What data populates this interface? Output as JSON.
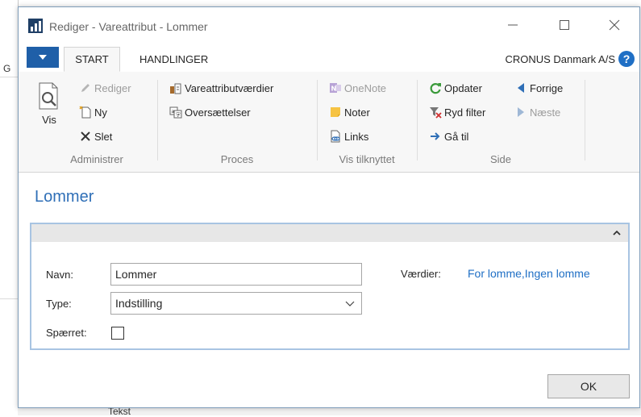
{
  "window": {
    "title": "Rediger - Vareattribut - Lommer"
  },
  "background": {
    "left_letter": "G",
    "bottom_text": "Tekst"
  },
  "tabs": {
    "start": "START",
    "handlinger": "HANDLINGER"
  },
  "company": "CRONUS Danmark A/S",
  "help": "?",
  "ribbon": {
    "vis": "Vis",
    "rediger": "Rediger",
    "ny": "Ny",
    "slet": "Slet",
    "group_administrer": "Administrer",
    "vareattributvaerdier": "Vareattributværdier",
    "oversaettelser": "Oversættelser",
    "group_proces": "Proces",
    "onenote": "OneNote",
    "noter": "Noter",
    "links": "Links",
    "group_vis_tilknyttet": "Vis tilknyttet",
    "opdater": "Opdater",
    "ryd_filter": "Ryd filter",
    "ga_til": "Gå til",
    "forrige": "Forrige",
    "naeste": "Næste",
    "group_side": "Side"
  },
  "page": {
    "heading": "Lommer"
  },
  "form": {
    "navn_label": "Navn:",
    "navn_value": "Lommer",
    "type_label": "Type:",
    "type_value": "Indstilling",
    "spaerret_label": "Spærret:",
    "vaerdier_label": "Værdier:",
    "vaerdier_value": "For lomme,Ingen lomme"
  },
  "buttons": {
    "ok": "OK"
  }
}
